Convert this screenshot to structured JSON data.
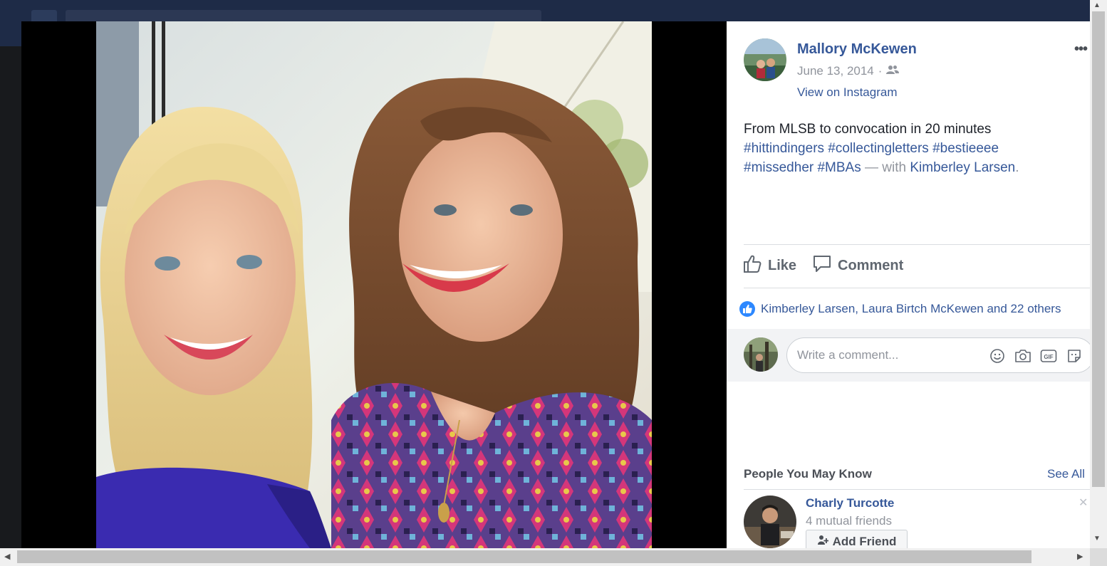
{
  "post": {
    "author": "Mallory McKewen",
    "date": "June 13, 2014",
    "date_separator": "·",
    "audience_icon": "friends-icon",
    "source_link": "View on Instagram",
    "more_label": "•••",
    "caption_text": "From MLSB to convocation in 20 minutes",
    "hashtags_line1": "#hittindingers #collectingletters #bestieeee",
    "hashtags_line2": "#missedher #MBAs",
    "with_label": "— with",
    "tagged_person": "Kimberley Larsen",
    "end_period": "."
  },
  "actions": {
    "like_label": "Like",
    "comment_label": "Comment"
  },
  "reactions": {
    "summary": "Kimberley Larsen, Laura Birtch McKewen and 22 others"
  },
  "comment_input": {
    "placeholder": "Write a comment...",
    "icons": [
      "emoji-icon",
      "camera-icon",
      "gif-icon",
      "sticker-icon"
    ],
    "gif_text": "GIF"
  },
  "people_you_may_know": {
    "title": "People You May Know",
    "see_all": "See All",
    "person_name": "Charly Turcotte",
    "mutual_friends": "4 mutual friends",
    "add_friend_label": "Add Friend"
  },
  "colors": {
    "link_blue": "#365899",
    "muted_gray": "#90949c",
    "like_blue": "#2d88ff",
    "header_dark": "#1e2b47"
  }
}
